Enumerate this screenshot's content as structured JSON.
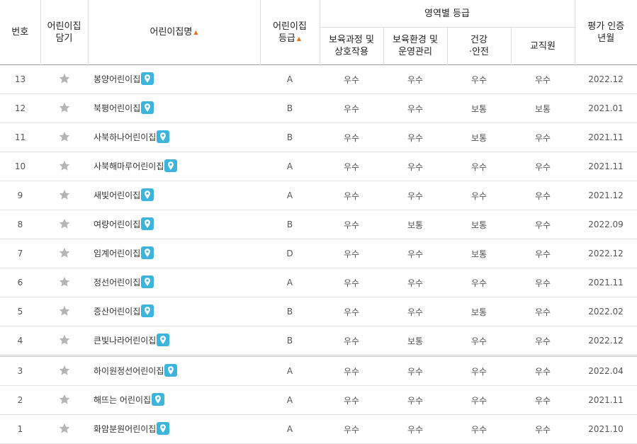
{
  "header": {
    "no": "번호",
    "fav": "어린이집\n담기",
    "name": "어린이집명",
    "grade": "어린이집\n등급",
    "area_group": "영역별 등급",
    "area1": "보육과정 및\n상호작용",
    "area2": "보육환경 및\n운영관리",
    "area3": "건강\n·안전",
    "area4": "교직원",
    "date": "평가 인증\n년월",
    "sort_indicator": "▲"
  },
  "icons": {
    "favorite": "star-icon",
    "map": "map-pin-icon"
  },
  "colors": {
    "pin": "#3cb4dc",
    "sort_arrow": "#e8731e",
    "star": "#b5b5b5"
  },
  "rows": [
    {
      "no": "13",
      "name": "봉양어린이집",
      "grade": "A",
      "a1": "우수",
      "a2": "우수",
      "a3": "우수",
      "a4": "우수",
      "date": "2022.12"
    },
    {
      "no": "12",
      "name": "북평어린이집",
      "grade": "B",
      "a1": "우수",
      "a2": "우수",
      "a3": "보통",
      "a4": "보통",
      "date": "2021.01"
    },
    {
      "no": "11",
      "name": "사북하나어린이집",
      "grade": "B",
      "a1": "우수",
      "a2": "우수",
      "a3": "보통",
      "a4": "우수",
      "date": "2021.11"
    },
    {
      "no": "10",
      "name": "사북해마루어린이집",
      "grade": "A",
      "a1": "우수",
      "a2": "우수",
      "a3": "우수",
      "a4": "우수",
      "date": "2021.11"
    },
    {
      "no": "9",
      "name": "새빛어린이집",
      "grade": "A",
      "a1": "우수",
      "a2": "우수",
      "a3": "우수",
      "a4": "우수",
      "date": "2021.12"
    },
    {
      "no": "8",
      "name": "여량어린이집",
      "grade": "B",
      "a1": "우수",
      "a2": "보통",
      "a3": "보통",
      "a4": "우수",
      "date": "2022.09"
    },
    {
      "no": "7",
      "name": "임계어린이집",
      "grade": "D",
      "a1": "우수",
      "a2": "우수",
      "a3": "보통",
      "a4": "우수",
      "date": "2022.12"
    },
    {
      "no": "6",
      "name": "정선어린이집",
      "grade": "A",
      "a1": "우수",
      "a2": "우수",
      "a3": "우수",
      "a4": "우수",
      "date": "2021.11"
    },
    {
      "no": "5",
      "name": "증산어린이집",
      "grade": "B",
      "a1": "우수",
      "a2": "우수",
      "a3": "보통",
      "a4": "우수",
      "date": "2022.02"
    },
    {
      "no": "4",
      "name": "큰빛나라어린이집",
      "grade": "B",
      "a1": "우수",
      "a2": "보통",
      "a3": "우수",
      "a4": "우수",
      "date": "2022.12"
    },
    {
      "no": "3",
      "name": "하이원정선어린이집",
      "grade": "A",
      "a1": "우수",
      "a2": "우수",
      "a3": "우수",
      "a4": "우수",
      "date": "2022.04"
    },
    {
      "no": "2",
      "name": "해뜨는 어린이집",
      "grade": "A",
      "a1": "우수",
      "a2": "우수",
      "a3": "우수",
      "a4": "우수",
      "date": "2021.11"
    },
    {
      "no": "1",
      "name": "화암분원어린이집",
      "grade": "A",
      "a1": "우수",
      "a2": "우수",
      "a3": "우수",
      "a4": "우수",
      "date": "2021.10"
    }
  ]
}
